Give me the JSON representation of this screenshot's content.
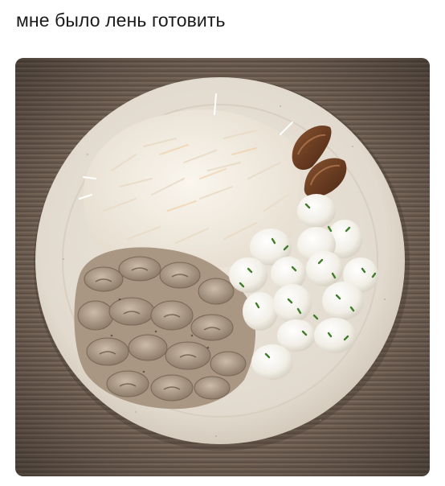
{
  "post": {
    "caption": "мне было лень готовить"
  },
  "photo": {
    "subject": "plate-of-rice-mushrooms-quail-eggs",
    "colors": {
      "tablecloth": "#6f5f53",
      "plate": "#e6dfd3",
      "rice": "#f3eee4",
      "mushroom": "#b9a896",
      "egg": "#f4f1ea",
      "chive": "#3f7d2a",
      "sausage": "#6a3d22"
    }
  }
}
